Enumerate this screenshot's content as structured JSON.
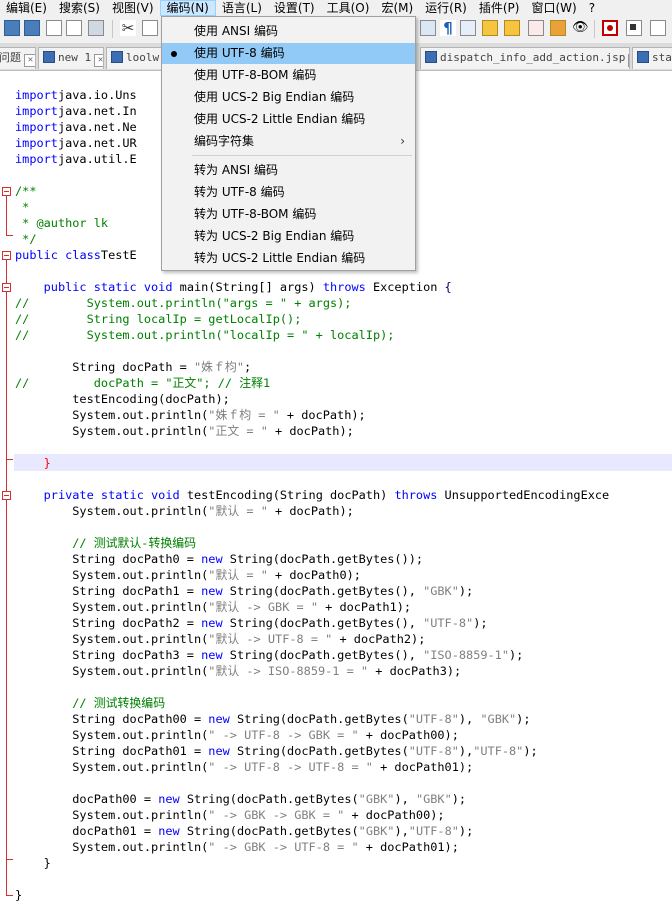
{
  "menubar": {
    "items": [
      {
        "label": "编辑(E)"
      },
      {
        "label": "搜索(S)"
      },
      {
        "label": "视图(V)"
      },
      {
        "label": "编码(N)"
      },
      {
        "label": "语言(L)"
      },
      {
        "label": "设置(T)"
      },
      {
        "label": "工具(O)"
      },
      {
        "label": "宏(M)"
      },
      {
        "label": "运行(R)"
      },
      {
        "label": "插件(P)"
      },
      {
        "label": "窗口(W)"
      },
      {
        "label": "?"
      }
    ]
  },
  "tabs": [
    {
      "label": "问题"
    },
    {
      "label": "new 1"
    },
    {
      "label": "loolw"
    },
    {
      "label": "dispatch_info_add_action.jsp"
    },
    {
      "label": "sta"
    }
  ],
  "encoding_menu": {
    "items": [
      {
        "label": "使用 ANSI 编码"
      },
      {
        "label": "使用 UTF-8 编码",
        "checked": true
      },
      {
        "label": "使用 UTF-8-BOM 编码"
      },
      {
        "label": "使用 UCS-2 Big Endian 编码"
      },
      {
        "label": "使用 UCS-2 Little Endian 编码"
      },
      {
        "label": "编码字符集",
        "submenu_arrow": "›"
      },
      {
        "label": "转为 ANSI 编码"
      },
      {
        "label": "转为 UTF-8 编码"
      },
      {
        "label": "转为 UTF-8-BOM 编码"
      },
      {
        "label": "转为 UCS-2 Big Endian 编码"
      },
      {
        "label": "转为 UCS-2 Little Endian 编码"
      }
    ]
  },
  "code_lines": [
    [
      [
        "kw",
        "import"
      ],
      [
        "",
        "java.io.Uns"
      ]
    ],
    [
      [
        "kw",
        "import"
      ],
      [
        "",
        "java.net.In"
      ]
    ],
    [
      [
        "kw",
        "import"
      ],
      [
        "",
        "java.net.Ne"
      ]
    ],
    [
      [
        "kw",
        "import"
      ],
      [
        "",
        "java.net.UR"
      ]
    ],
    [
      [
        "kw",
        "import"
      ],
      [
        "",
        "java.util.E"
      ]
    ],
    [
      [
        "",
        ""
      ]
    ],
    [
      [
        "cm",
        "/**"
      ]
    ],
    [
      [
        "cm",
        " *"
      ]
    ],
    [
      [
        "cm",
        " * @author lk"
      ]
    ],
    [
      [
        "cm",
        " */"
      ]
    ],
    [
      [
        "kw",
        "public"
      ],
      [
        "",
        ""
      ],
      [
        "kw",
        "class"
      ],
      [
        "",
        "TestE"
      ]
    ],
    [
      [
        "",
        ""
      ]
    ],
    [
      [
        "",
        "    "
      ],
      [
        "kw",
        "public static void"
      ],
      [
        "",
        " main(String[] args) "
      ],
      [
        "kw",
        "throws"
      ],
      [
        "",
        " Exception "
      ],
      [
        "op",
        "{"
      ]
    ],
    [
      [
        "cm",
        "//        System.out.println(\"args = \" + args);"
      ]
    ],
    [
      [
        "cm",
        "//        String localIp = getLocalIp();"
      ]
    ],
    [
      [
        "cm",
        "//        System.out.println(\"localIp = \" + localIp);"
      ]
    ],
    [
      [
        "",
        ""
      ]
    ],
    [
      [
        "",
        "        String docPath = "
      ],
      [
        "st",
        "\"姝ｆ枃\""
      ],
      [
        "",
        ";"
      ]
    ],
    [
      [
        "cm",
        "//         docPath = \"正文\"; // 注释1"
      ]
    ],
    [
      [
        "",
        "        testEncoding(docPath);"
      ]
    ],
    [
      [
        "",
        "        System.out.println("
      ],
      [
        "st",
        "\"姝ｆ枃 = \""
      ],
      [
        "",
        " + docPath);"
      ]
    ],
    [
      [
        "",
        "        System.out.println("
      ],
      [
        "st",
        "\"正文 = \""
      ],
      [
        "",
        " + docPath);"
      ]
    ],
    [
      [
        "",
        ""
      ]
    ],
    [
      [
        "",
        "    "
      ],
      [
        "rd",
        "}"
      ]
    ],
    [
      [
        "",
        ""
      ]
    ],
    [
      [
        "",
        "    "
      ],
      [
        "kw",
        "private static void"
      ],
      [
        "",
        " testEncoding(String docPath) "
      ],
      [
        "kw",
        "throws"
      ],
      [
        "",
        " UnsupportedEncodingExce"
      ]
    ],
    [
      [
        "",
        "        System.out.println("
      ],
      [
        "st",
        "\"默认 = \""
      ],
      [
        "",
        " + docPath);"
      ]
    ],
    [
      [
        "",
        ""
      ]
    ],
    [
      [
        "cm",
        "        // 测试默认-转换编码"
      ]
    ],
    [
      [
        "",
        "        String docPath0 = "
      ],
      [
        "kw",
        "new"
      ],
      [
        "",
        " String(docPath.getBytes());"
      ]
    ],
    [
      [
        "",
        "        System.out.println("
      ],
      [
        "st",
        "\"默认 = \""
      ],
      [
        "",
        " + docPath0);"
      ]
    ],
    [
      [
        "",
        "        String docPath1 = "
      ],
      [
        "kw",
        "new"
      ],
      [
        "",
        " String(docPath.getBytes(), "
      ],
      [
        "st",
        "\"GBK\""
      ],
      [
        "",
        ");"
      ]
    ],
    [
      [
        "",
        "        System.out.println("
      ],
      [
        "st",
        "\"默认 -> GBK = \""
      ],
      [
        "",
        " + docPath1);"
      ]
    ],
    [
      [
        "",
        "        String docPath2 = "
      ],
      [
        "kw",
        "new"
      ],
      [
        "",
        " String(docPath.getBytes(), "
      ],
      [
        "st",
        "\"UTF-8\""
      ],
      [
        "",
        ");"
      ]
    ],
    [
      [
        "",
        "        System.out.println("
      ],
      [
        "st",
        "\"默认 -> UTF-8 = \""
      ],
      [
        "",
        " + docPath2);"
      ]
    ],
    [
      [
        "",
        "        String docPath3 = "
      ],
      [
        "kw",
        "new"
      ],
      [
        "",
        " String(docPath.getBytes(), "
      ],
      [
        "st",
        "\"ISO-8859-1\""
      ],
      [
        "",
        ");"
      ]
    ],
    [
      [
        "",
        "        System.out.println("
      ],
      [
        "st",
        "\"默认 -> ISO-8859-1 = \""
      ],
      [
        "",
        " + docPath3);"
      ]
    ],
    [
      [
        "",
        ""
      ]
    ],
    [
      [
        "cm",
        "        // 测试转换编码"
      ]
    ],
    [
      [
        "",
        "        String docPath00 = "
      ],
      [
        "kw",
        "new"
      ],
      [
        "",
        " String(docPath.getBytes("
      ],
      [
        "st",
        "\"UTF-8\""
      ],
      [
        "",
        "), "
      ],
      [
        "st",
        "\"GBK\""
      ],
      [
        "",
        ");"
      ]
    ],
    [
      [
        "",
        "        System.out.println("
      ],
      [
        "st",
        "\" -> UTF-8 -> GBK = \""
      ],
      [
        "",
        " + docPath00);"
      ]
    ],
    [
      [
        "",
        "        String docPath01 = "
      ],
      [
        "kw",
        "new"
      ],
      [
        "",
        " String(docPath.getBytes("
      ],
      [
        "st",
        "\"UTF-8\""
      ],
      [
        "",
        "),"
      ],
      [
        "st",
        "\"UTF-8\""
      ],
      [
        "",
        ");"
      ]
    ],
    [
      [
        "",
        "        System.out.println("
      ],
      [
        "st",
        "\" -> UTF-8 -> UTF-8 = \""
      ],
      [
        "",
        " + docPath01);"
      ]
    ],
    [
      [
        "",
        ""
      ]
    ],
    [
      [
        "",
        "        docPath00 = "
      ],
      [
        "kw",
        "new"
      ],
      [
        "",
        " String(docPath.getBytes("
      ],
      [
        "st",
        "\"GBK\""
      ],
      [
        "",
        "), "
      ],
      [
        "st",
        "\"GBK\""
      ],
      [
        "",
        ");"
      ]
    ],
    [
      [
        "",
        "        System.out.println("
      ],
      [
        "st",
        "\" -> GBK -> GBK = \""
      ],
      [
        "",
        " + docPath00);"
      ]
    ],
    [
      [
        "",
        "        docPath01 = "
      ],
      [
        "kw",
        "new"
      ],
      [
        "",
        " String(docPath.getBytes("
      ],
      [
        "st",
        "\"GBK\""
      ],
      [
        "",
        "),"
      ],
      [
        "st",
        "\"UTF-8\""
      ],
      [
        "",
        ");"
      ]
    ],
    [
      [
        "",
        "        System.out.println("
      ],
      [
        "st",
        "\" -> GBK -> UTF-8 = \""
      ],
      [
        "",
        " + docPath01);"
      ]
    ],
    [
      [
        "",
        "    }"
      ]
    ],
    [
      [
        "",
        ""
      ]
    ],
    [
      [
        "",
        "}"
      ]
    ]
  ]
}
